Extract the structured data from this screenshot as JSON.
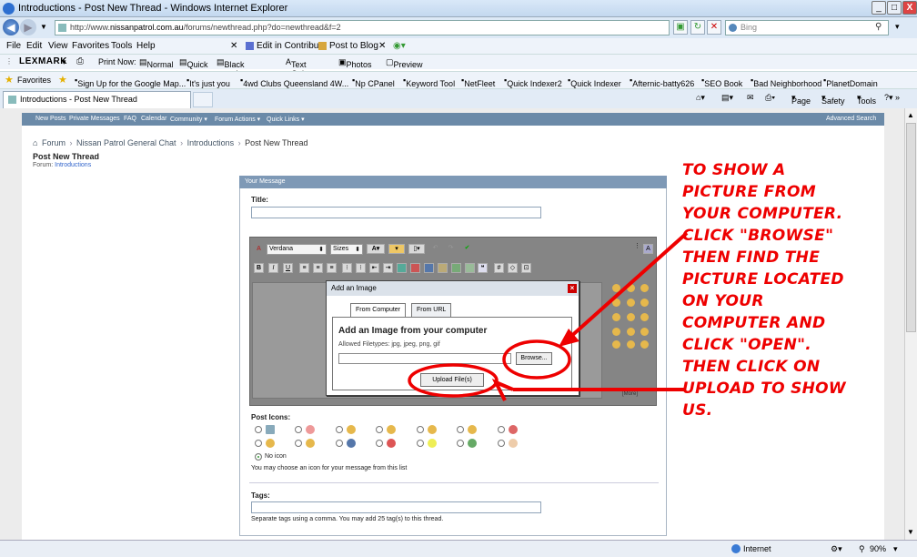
{
  "window": {
    "title": "Introductions - Post New Thread - Windows Internet Explorer",
    "min": "_",
    "max": "□",
    "close": "X"
  },
  "address": {
    "url_prefix": "http://www.",
    "url_host": "nissanpatrol.com.au",
    "url_path": "/forums/newthread.php?do=newthread&f=2",
    "search_placeholder": "Bing"
  },
  "menu": {
    "file": "File",
    "edit": "Edit",
    "view": "View",
    "favorites": "Favorites",
    "tools": "Tools",
    "help": "Help",
    "contribute": "Edit in Contribute",
    "post_blog": "Post to Blog"
  },
  "lexmark": {
    "brand": "LEXMARK",
    "print_now": "Print Now:",
    "normal": "Normal",
    "quick": "Quick",
    "bw": "Black and White",
    "text_only": "Text Only",
    "photos": "Photos",
    "preview": "Preview"
  },
  "favbar": {
    "favorites": "Favorites",
    "items": [
      "Sign Up for the Google Map...",
      "It's just you",
      "4wd Clubs  Queensland  4W...",
      "Np CPanel",
      "Keyword Tool",
      "NetFleet",
      "Quick Indexer2",
      "Quick Indexer",
      "Afternic-batty626",
      "SEO Book",
      "Bad Neighborhood",
      "PlanetDomain"
    ]
  },
  "tab": {
    "label": "Introductions - Post New Thread",
    "page": "Page",
    "safety": "Safety",
    "tools": "Tools"
  },
  "sitenav": {
    "items": [
      "New Posts",
      "Private Messages",
      "FAQ",
      "Calendar",
      "Community ▾",
      "Forum Actions ▾",
      "Quick Links ▾"
    ],
    "advanced": "Advanced Search"
  },
  "breadcrumb": {
    "forum": "Forum",
    "general": "Nissan Patrol General Chat",
    "intro": "Introductions",
    "current": "Post New Thread"
  },
  "page": {
    "title": "Post New Thread",
    "forum_label": "Forum:",
    "forum_link": "Introductions"
  },
  "message": {
    "header": "Your Message",
    "title_label": "Title:",
    "font": "Verdana",
    "sizes": "Sizes",
    "more": "[More]"
  },
  "dialog": {
    "title": "Add an Image",
    "tab_computer": "From Computer",
    "tab_url": "From URL",
    "heading": "Add an Image from your computer",
    "allowed": "Allowed Filetypes: jpg, jpeg, png, gif",
    "browse": "Browse...",
    "upload": "Upload File(s)"
  },
  "post_icons": {
    "label": "Post Icons:",
    "no_icon": "No icon",
    "hint": "You may choose an icon for your message from this list"
  },
  "tags": {
    "label": "Tags:",
    "hint": "Separate tags using a comma. You may add 25 tag(s) to this thread."
  },
  "status": {
    "zone": "Internet",
    "zoom": "90%"
  },
  "annotation": {
    "lines": [
      "TO SHOW A",
      "PICTURE FROM",
      "YOUR COMPUTER.",
      "CLICK \"BROWSE\"",
      "THEN FIND THE",
      "PICTURE LOCATED",
      "ON YOUR",
      "COMPUTER AND",
      "CLICK \"OPEN\".",
      "THEN CLICK ON",
      "UPLOAD TO SHOW",
      "US."
    ],
    "color": "#e00000"
  }
}
